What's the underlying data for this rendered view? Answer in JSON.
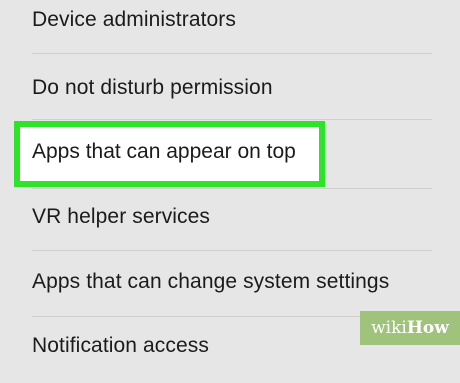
{
  "settings": {
    "items": [
      {
        "label": "Device administrators"
      },
      {
        "label": "Do not disturb permission"
      },
      {
        "label": "Apps that can appear on top"
      },
      {
        "label": "VR helper services"
      },
      {
        "label": "Apps that can change system settings"
      },
      {
        "label": "Notification access"
      }
    ],
    "highlighted_item": "Apps that can appear on top"
  },
  "watermark": {
    "prefix": "wiki",
    "suffix": "How"
  },
  "colors": {
    "background": "#e6e6e6",
    "highlight": "#2fe22a",
    "text": "#1b1b1b",
    "watermark_bg": "#9fc37a"
  }
}
